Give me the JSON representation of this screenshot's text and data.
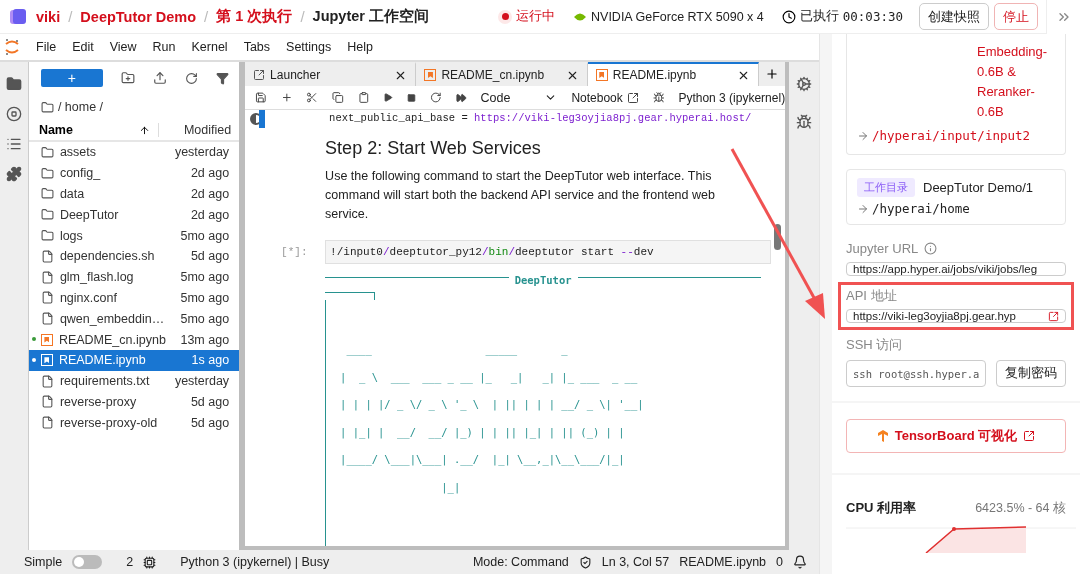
{
  "top_bar": {
    "separator": "/",
    "breadcrumb": [
      {
        "text": "viki",
        "kind": "link"
      },
      {
        "text": "DeepTutor Demo",
        "kind": "link"
      },
      {
        "text": "第 1 次执行",
        "kind": "link"
      },
      {
        "text": "Jupyter 工作空间",
        "kind": "current"
      }
    ],
    "status": "运行中",
    "gpu": "NVIDIA GeForce RTX 5090 x 4",
    "elapsed_label": "已执行",
    "elapsed": "00:03:30",
    "buttons": [
      {
        "label": "创建快照",
        "kind": "default"
      },
      {
        "label": "停止",
        "kind": "danger"
      }
    ]
  },
  "menu": [
    "File",
    "Edit",
    "View",
    "Run",
    "Kernel",
    "Tabs",
    "Settings",
    "Help"
  ],
  "file_browser": {
    "new_label": "+",
    "path": "/ home /",
    "columns": [
      "Name",
      "Modified"
    ],
    "files": [
      {
        "name": "assets",
        "modified": "yesterday",
        "kind": "folder",
        "running": false,
        "selected": false
      },
      {
        "name": "config_",
        "modified": "2d ago",
        "kind": "folder",
        "running": false,
        "selected": false
      },
      {
        "name": "data",
        "modified": "2d ago",
        "kind": "folder",
        "running": false,
        "selected": false
      },
      {
        "name": "DeepTutor",
        "modified": "2d ago",
        "kind": "folder",
        "running": false,
        "selected": false
      },
      {
        "name": "logs",
        "modified": "5mo ago",
        "kind": "folder",
        "running": false,
        "selected": false
      },
      {
        "name": "dependencies.sh",
        "modified": "5d ago",
        "kind": "file",
        "running": false,
        "selected": false
      },
      {
        "name": "glm_flash.log",
        "modified": "5mo ago",
        "kind": "file",
        "running": false,
        "selected": false
      },
      {
        "name": "nginx.conf",
        "modified": "5mo ago",
        "kind": "file",
        "running": false,
        "selected": false
      },
      {
        "name": "qwen_embeddin…",
        "modified": "5mo ago",
        "kind": "file",
        "running": false,
        "selected": false
      },
      {
        "name": "README_cn.ipynb",
        "modified": "13m ago",
        "kind": "notebook",
        "running": true,
        "selected": false
      },
      {
        "name": "README.ipynb",
        "modified": "1s ago",
        "kind": "notebook",
        "running": true,
        "selected": true
      },
      {
        "name": "requirements.txt",
        "modified": "yesterday",
        "kind": "file",
        "running": false,
        "selected": false
      },
      {
        "name": "reverse-proxy",
        "modified": "5d ago",
        "kind": "file",
        "running": false,
        "selected": false
      },
      {
        "name": "reverse-proxy-old",
        "modified": "5d ago",
        "kind": "file",
        "running": false,
        "selected": false
      }
    ]
  },
  "tabs": [
    {
      "label": "Launcher",
      "kind": "launcher",
      "selected": false
    },
    {
      "label": "README_cn.ipynb",
      "kind": "notebook",
      "selected": false
    },
    {
      "label": "README.ipynb",
      "kind": "notebook",
      "selected": true
    }
  ],
  "toolbar": {
    "cell_type": "Code",
    "notebook_label": "Notebook",
    "kernel": "Python 3 (ipykernel)"
  },
  "notebook": {
    "code_line": [
      {
        "text": "next_public_api_base = ",
        "kind": "plain"
      },
      {
        "text": "https://viki-leg3oyjia8pj.gear.hyperai.host/",
        "kind": "string"
      }
    ],
    "heading": "Step 2: Start Web Services",
    "paragraph": "Use the following command to start the DeepTutor web interface. This command will start both the backend API service and the frontend web service.",
    "prompt": "[*]:",
    "command": [
      {
        "text": "!/input0",
        "kind": "plain"
      },
      {
        "text": "/",
        "kind": "op"
      },
      {
        "text": "deeptutor_py12",
        "kind": "plain"
      },
      {
        "text": "/",
        "kind": "op"
      },
      {
        "text": "bin",
        "kind": "builtin"
      },
      {
        "text": "/",
        "kind": "op"
      },
      {
        "text": "deeptutor start ",
        "kind": "plain"
      },
      {
        "text": "--",
        "kind": "op"
      },
      {
        "text": "dev",
        "kind": "plain"
      }
    ],
    "output_title": "DeepTutor",
    "art": [
      " ____                  _____       _",
      "|  _ \\  ___  ___ _ __ |_   _|   _| |_ ___  _ __",
      "| | | |/ _ \\/ _ \\ '_ \\  | || | | | __/ _ \\| '__|",
      "| |_| |  __/  __/ |_) | | || |_| | || (_) | |",
      "|____/ \\___|\\___| .__/  |_| \\__,_|\\__\\___/|_|",
      "                |_|"
    ]
  },
  "status_bar": {
    "simple_label": "Simple",
    "simple_on": false,
    "terminals": "2",
    "kernel_status": "Python 3 (ipykernel) | Busy",
    "mode": "Mode: Command",
    "position": "Ln 3, Col 57",
    "file": "README.ipynb",
    "notifications": "0"
  },
  "side_panel": {
    "model_lines": [
      "Embedding-",
      "0.6B &",
      "Reranker-",
      "0.6B"
    ],
    "model_path": "/hyperai/input/input2",
    "workdir": {
      "tag": "工作目录",
      "name": "DeepTutor Demo/1",
      "path": "/hyperai/home"
    },
    "jupyter_url": {
      "label": "Jupyter URL",
      "value": "https://app.hyper.ai/jobs/viki/jobs/leg"
    },
    "api": {
      "label": "API 地址",
      "value": "https://viki-leg3oyjia8pj.gear.hyp"
    },
    "ssh": {
      "label": "SSH 访问",
      "value": "ssh root@ssh.hyper.a",
      "button": "复制密码"
    },
    "tensorboard": "TensorBoard 可视化",
    "cpu": {
      "label": "CPU 利用率",
      "value": "6423.5% - 64 核"
    }
  }
}
